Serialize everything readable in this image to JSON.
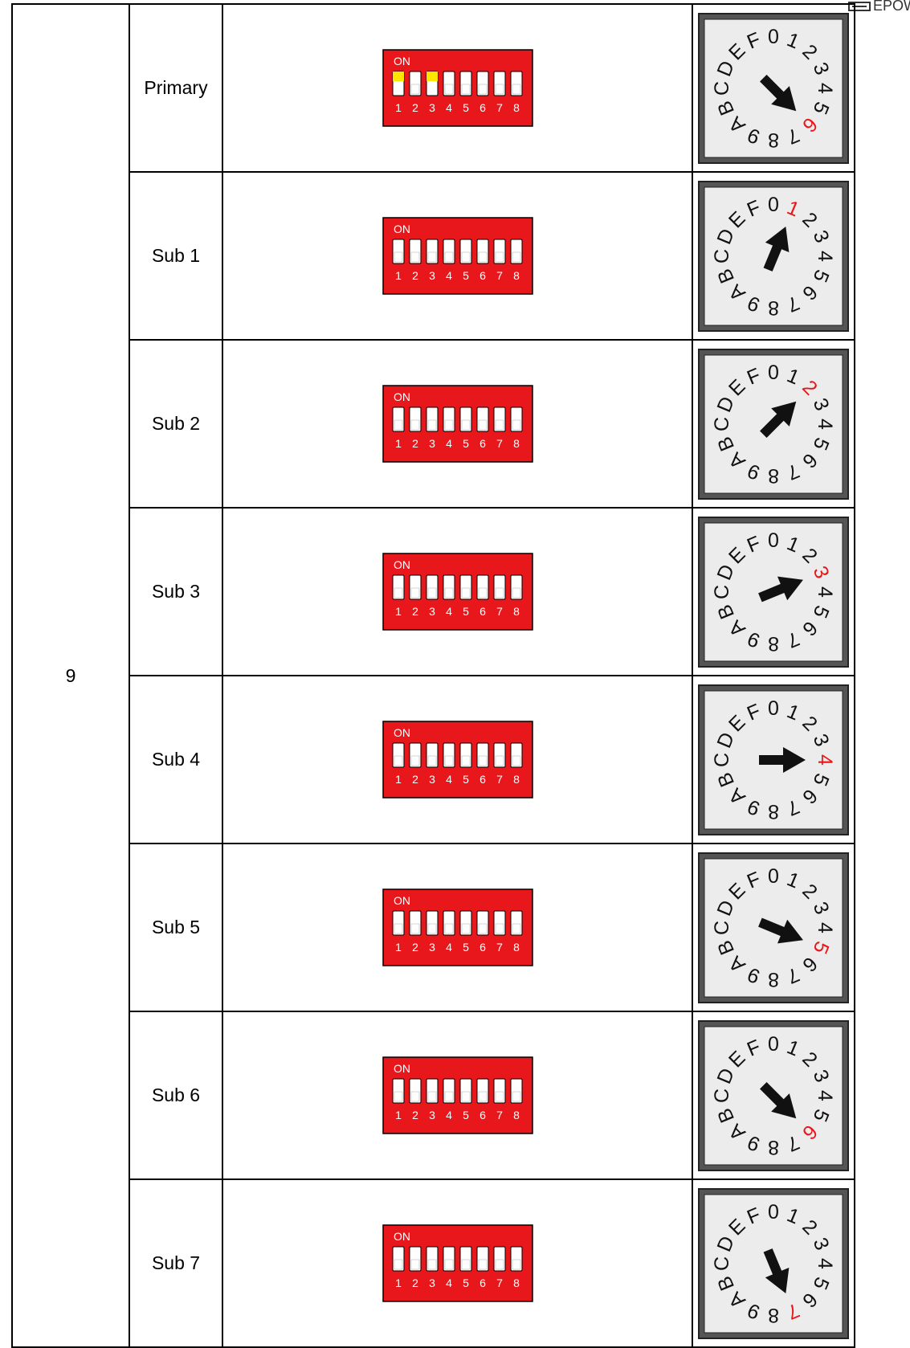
{
  "header": {
    "logo": "EPOWER"
  },
  "group": "9",
  "dip_labels": {
    "on": "ON",
    "numbers": [
      "1",
      "2",
      "3",
      "4",
      "5",
      "6",
      "7",
      "8"
    ]
  },
  "dial_labels": [
    "0",
    "1",
    "2",
    "3",
    "4",
    "5",
    "6",
    "7",
    "8",
    "9",
    "A",
    "B",
    "C",
    "D",
    "E",
    "F"
  ],
  "colors": {
    "dip_body": "#e8171c",
    "switch_on": "#ffe600",
    "switch_body": "#ffffff",
    "dial_selected": "#e8171c",
    "dial_face": "#ececec",
    "dial_frame": "#3a3a3a"
  },
  "rows": [
    {
      "role": "Primary",
      "dip_on": [
        1,
        3
      ],
      "dial": "6"
    },
    {
      "role": "Sub 1",
      "dip_on": [],
      "dial": "1"
    },
    {
      "role": "Sub 2",
      "dip_on": [],
      "dial": "2"
    },
    {
      "role": "Sub 3",
      "dip_on": [],
      "dial": "3"
    },
    {
      "role": "Sub 4",
      "dip_on": [],
      "dial": "4"
    },
    {
      "role": "Sub 5",
      "dip_on": [],
      "dial": "5"
    },
    {
      "role": "Sub 6",
      "dip_on": [],
      "dial": "6"
    },
    {
      "role": "Sub 7",
      "dip_on": [],
      "dial": "7"
    }
  ]
}
